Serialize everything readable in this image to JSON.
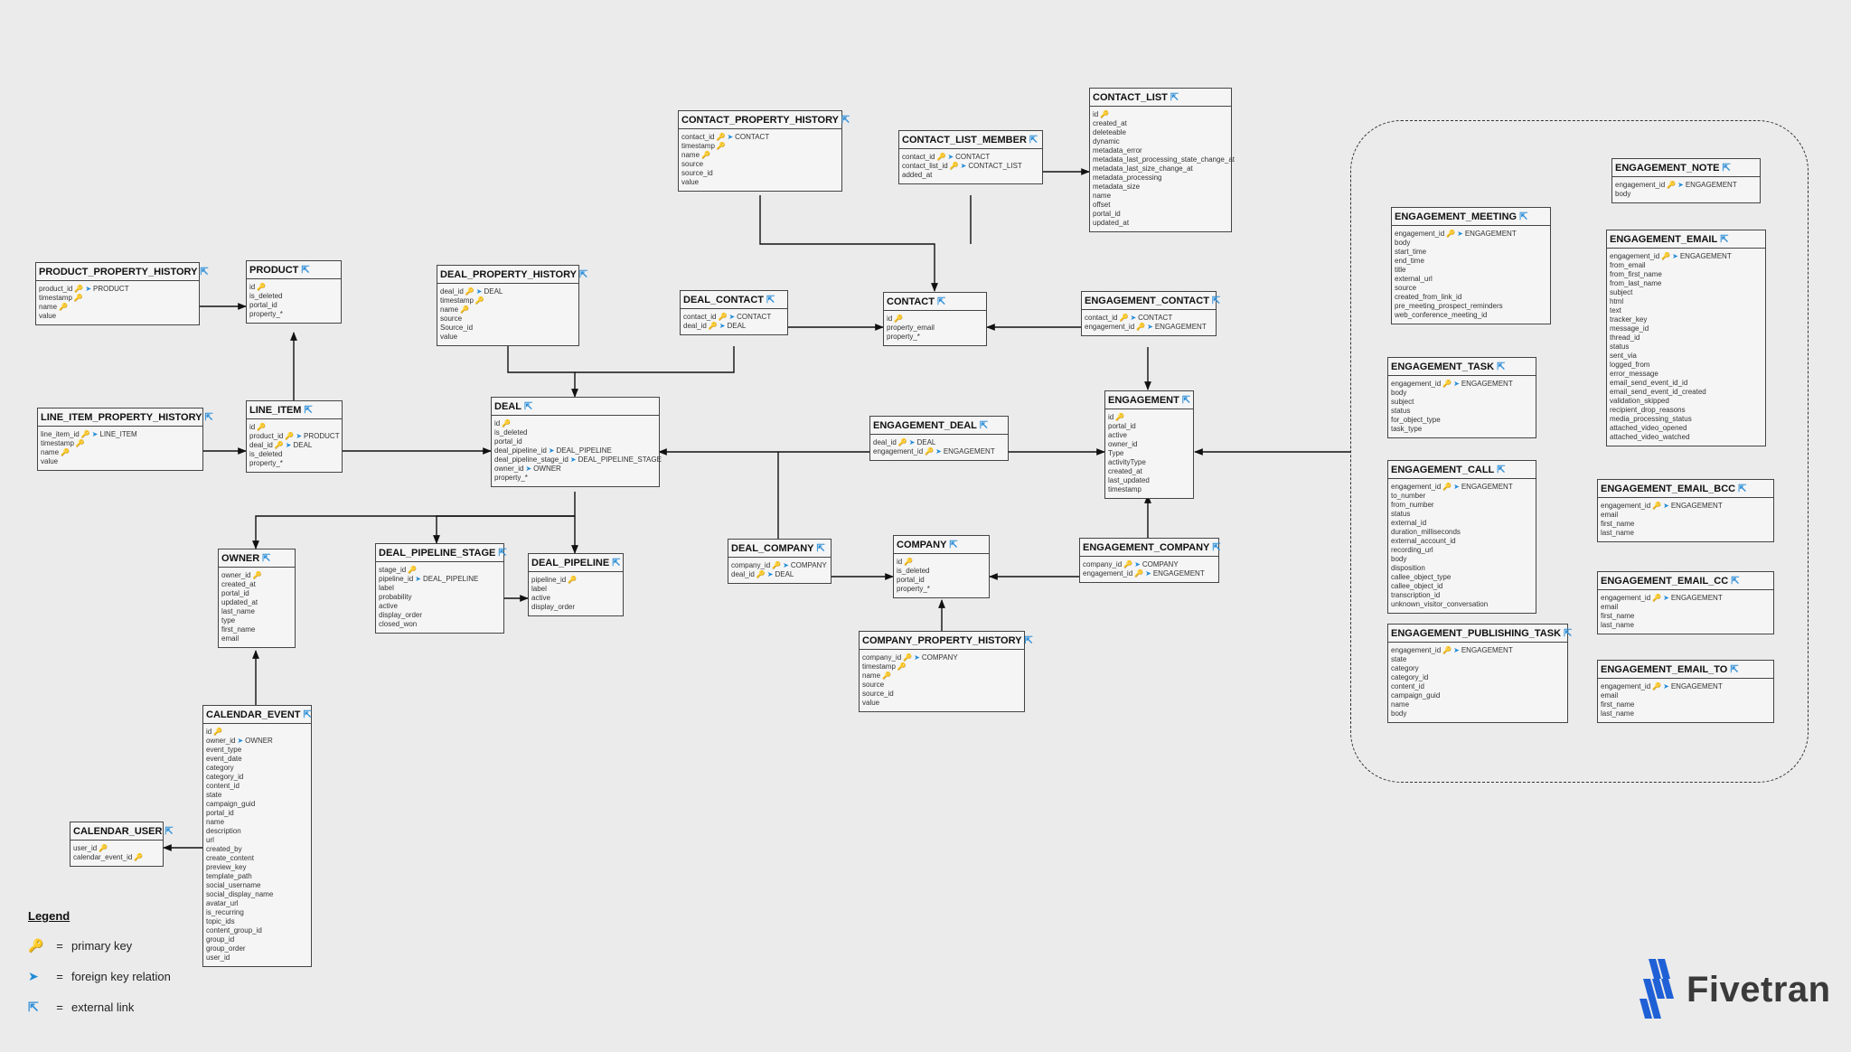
{
  "icons": {
    "primary_key": "key-icon",
    "foreign_key": "arrow-right-icon",
    "external_link": "external-link-icon"
  },
  "colors": {
    "background": "#ebebeb",
    "table_fill": "#f5f5f5",
    "border": "#444444",
    "pk": "#e0a81c",
    "fk": "#1f8ad8",
    "logo_blue": "#1f60d6"
  },
  "tables": [
    {
      "id": "CONTACT_PROPERTY_HISTORY",
      "name": "CONTACT_PROPERTY_HISTORY",
      "columns": [
        {
          "name": "contact_id",
          "pk": true,
          "fk": "CONTACT"
        },
        {
          "name": "timestamp",
          "pk": true
        },
        {
          "name": "name",
          "pk": true
        },
        {
          "name": "source"
        },
        {
          "name": "source_id"
        },
        {
          "name": "value"
        }
      ]
    },
    {
      "id": "CONTACT_LIST_MEMBER",
      "name": "CONTACT_LIST_MEMBER",
      "columns": [
        {
          "name": "contact_id",
          "pk": true,
          "fk": "CONTACT"
        },
        {
          "name": "contact_list_id",
          "pk": true,
          "fk": "CONTACT_LIST"
        },
        {
          "name": "added_at"
        }
      ]
    },
    {
      "id": "CONTACT_LIST",
      "name": "CONTACT_LIST",
      "columns": [
        {
          "name": "id",
          "pk": true
        },
        {
          "name": "created_at"
        },
        {
          "name": "deleteable"
        },
        {
          "name": "dynamic"
        },
        {
          "name": "metadata_error"
        },
        {
          "name": "metadata_last_processing_state_change_at"
        },
        {
          "name": "metadata_last_size_change_at"
        },
        {
          "name": "metadata_processing"
        },
        {
          "name": "metadata_size"
        },
        {
          "name": "name"
        },
        {
          "name": "offset"
        },
        {
          "name": "portal_id"
        },
        {
          "name": "updated_at"
        }
      ]
    },
    {
      "id": "PRODUCT_PROPERTY_HISTORY",
      "name": "PRODUCT_PROPERTY_HISTORY",
      "columns": [
        {
          "name": "product_id",
          "pk": true,
          "fk": "PRODUCT"
        },
        {
          "name": "timestamp",
          "pk": true
        },
        {
          "name": "name",
          "pk": true
        },
        {
          "name": "value"
        }
      ]
    },
    {
      "id": "PRODUCT",
      "name": "PRODUCT",
      "columns": [
        {
          "name": "id",
          "pk": true
        },
        {
          "name": "is_deleted"
        },
        {
          "name": "portal_id"
        },
        {
          "name": "property_*"
        }
      ]
    },
    {
      "id": "DEAL_PROPERTY_HISTORY",
      "name": "DEAL_PROPERTY_HISTORY",
      "columns": [
        {
          "name": "deal_id",
          "pk": true,
          "fk": "DEAL"
        },
        {
          "name": "timestamp",
          "pk": true
        },
        {
          "name": "name",
          "pk": true
        },
        {
          "name": "source"
        },
        {
          "name": "Source_id"
        },
        {
          "name": "value"
        }
      ]
    },
    {
      "id": "DEAL_CONTACT",
      "name": "DEAL_CONTACT",
      "columns": [
        {
          "name": "contact_id",
          "pk": true,
          "fk": "CONTACT"
        },
        {
          "name": "deal_id",
          "pk": true,
          "fk": "DEAL"
        }
      ]
    },
    {
      "id": "CONTACT",
      "name": "CONTACT",
      "columns": [
        {
          "name": "id",
          "pk": true
        },
        {
          "name": "property_email"
        },
        {
          "name": "property_*"
        }
      ]
    },
    {
      "id": "ENGAGEMENT_CONTACT",
      "name": "ENGAGEMENT_CONTACT",
      "columns": [
        {
          "name": "contact_id",
          "pk": true,
          "fk": "CONTACT"
        },
        {
          "name": "engagement_id",
          "pk": true,
          "fk": "ENGAGEMENT"
        }
      ]
    },
    {
      "id": "LINE_ITEM_PROPERTY_HISTORY",
      "name": "LINE_ITEM_PROPERTY_HISTORY",
      "columns": [
        {
          "name": "line_item_id",
          "pk": true,
          "fk": "LINE_ITEM"
        },
        {
          "name": "timestamp",
          "pk": true
        },
        {
          "name": "name",
          "pk": true
        },
        {
          "name": "value"
        }
      ]
    },
    {
      "id": "LINE_ITEM",
      "name": "LINE_ITEM",
      "columns": [
        {
          "name": "id",
          "pk": true
        },
        {
          "name": "product_id",
          "pk": true,
          "fk": "PRODUCT"
        },
        {
          "name": "deal_id",
          "pk": true,
          "fk": "DEAL"
        },
        {
          "name": "is_deleted"
        },
        {
          "name": "property_*"
        }
      ]
    },
    {
      "id": "DEAL",
      "name": "DEAL",
      "columns": [
        {
          "name": "id",
          "pk": true
        },
        {
          "name": "is_deleted"
        },
        {
          "name": "portal_id"
        },
        {
          "name": "deal_pipeline_id",
          "fk": "DEAL_PIPELINE"
        },
        {
          "name": "deal_pipeline_stage_id",
          "fk": "DEAL_PIPELINE_STAGE"
        },
        {
          "name": "owner_id",
          "fk": "OWNER"
        },
        {
          "name": "property_*"
        }
      ]
    },
    {
      "id": "ENGAGEMENT_DEAL",
      "name": "ENGAGEMENT_DEAL",
      "columns": [
        {
          "name": "deal_id",
          "pk": true,
          "fk": "DEAL"
        },
        {
          "name": "engagement_id",
          "pk": true,
          "fk": "ENGAGEMENT"
        }
      ]
    },
    {
      "id": "ENGAGEMENT",
      "name": "ENGAGEMENT",
      "columns": [
        {
          "name": "id",
          "pk": true
        },
        {
          "name": "portal_id"
        },
        {
          "name": "active"
        },
        {
          "name": "owner_id"
        },
        {
          "name": "Type"
        },
        {
          "name": "activityType"
        },
        {
          "name": "created_at"
        },
        {
          "name": "last_updated"
        },
        {
          "name": "timestamp"
        }
      ]
    },
    {
      "id": "OWNER",
      "name": "OWNER",
      "columns": [
        {
          "name": "owner_id",
          "pk": true
        },
        {
          "name": "created_at"
        },
        {
          "name": "portal_id"
        },
        {
          "name": "updated_at"
        },
        {
          "name": "last_name"
        },
        {
          "name": "type"
        },
        {
          "name": "first_name"
        },
        {
          "name": "email"
        }
      ]
    },
    {
      "id": "DEAL_PIPELINE_STAGE",
      "name": "DEAL_PIPELINE_STAGE",
      "columns": [
        {
          "name": "stage_id",
          "pk": true
        },
        {
          "name": "pipeline_id",
          "fk": "DEAL_PIPELINE"
        },
        {
          "name": "label"
        },
        {
          "name": "probability"
        },
        {
          "name": "active"
        },
        {
          "name": "display_order"
        },
        {
          "name": "closed_won"
        }
      ]
    },
    {
      "id": "DEAL_PIPELINE",
      "name": "DEAL_PIPELINE",
      "columns": [
        {
          "name": "pipeline_id",
          "pk": true
        },
        {
          "name": "label"
        },
        {
          "name": "active"
        },
        {
          "name": "display_order"
        }
      ]
    },
    {
      "id": "DEAL_COMPANY",
      "name": "DEAL_COMPANY",
      "columns": [
        {
          "name": "company_id",
          "pk": true,
          "fk": "COMPANY"
        },
        {
          "name": "deal_id",
          "pk": true,
          "fk": "DEAL"
        }
      ]
    },
    {
      "id": "COMPANY",
      "name": "COMPANY",
      "columns": [
        {
          "name": "id",
          "pk": true
        },
        {
          "name": "is_deleted"
        },
        {
          "name": "portal_id"
        },
        {
          "name": "property_*"
        }
      ]
    },
    {
      "id": "ENGAGEMENT_COMPANY",
      "name": "ENGAGEMENT_COMPANY",
      "columns": [
        {
          "name": "company_id",
          "pk": true,
          "fk": "COMPANY"
        },
        {
          "name": "engagement_id",
          "pk": true,
          "fk": "ENGAGEMENT"
        }
      ]
    },
    {
      "id": "COMPANY_PROPERTY_HISTORY",
      "name": "COMPANY_PROPERTY_HISTORY",
      "columns": [
        {
          "name": "company_id",
          "pk": true,
          "fk": "COMPANY"
        },
        {
          "name": "timestamp",
          "pk": true
        },
        {
          "name": "name",
          "pk": true
        },
        {
          "name": "source"
        },
        {
          "name": "source_id"
        },
        {
          "name": "value"
        }
      ]
    },
    {
      "id": "CALENDAR_EVENT",
      "name": "CALENDAR_EVENT",
      "columns": [
        {
          "name": "id",
          "pk": true
        },
        {
          "name": "owner_id",
          "fk": "OWNER"
        },
        {
          "name": "event_type"
        },
        {
          "name": "event_date"
        },
        {
          "name": "category"
        },
        {
          "name": "category_id"
        },
        {
          "name": "content_id"
        },
        {
          "name": "state"
        },
        {
          "name": "campaign_guid"
        },
        {
          "name": "portal_id"
        },
        {
          "name": "name"
        },
        {
          "name": "description"
        },
        {
          "name": "url"
        },
        {
          "name": "created_by"
        },
        {
          "name": "create_content"
        },
        {
          "name": "preview_key"
        },
        {
          "name": "template_path"
        },
        {
          "name": "social_username"
        },
        {
          "name": "social_display_name"
        },
        {
          "name": "avatar_url"
        },
        {
          "name": "is_recurring"
        },
        {
          "name": "topic_ids"
        },
        {
          "name": "content_group_id"
        },
        {
          "name": "group_id"
        },
        {
          "name": "group_order"
        },
        {
          "name": "user_id"
        }
      ]
    },
    {
      "id": "CALENDAR_USER",
      "name": "CALENDAR_USER",
      "columns": [
        {
          "name": "user_id",
          "pk": true
        },
        {
          "name": "calendar_event_id",
          "pk": true
        }
      ]
    },
    {
      "id": "ENGAGEMENT_MEETING",
      "name": "ENGAGEMENT_MEETING",
      "columns": [
        {
          "name": "engagement_id",
          "pk": true,
          "fk": "ENGAGEMENT"
        },
        {
          "name": "body"
        },
        {
          "name": "start_time"
        },
        {
          "name": "end_time"
        },
        {
          "name": "title"
        },
        {
          "name": "external_url"
        },
        {
          "name": "source"
        },
        {
          "name": "created_from_link_id"
        },
        {
          "name": "pre_meeting_prospect_reminders"
        },
        {
          "name": "web_conference_meeting_id"
        }
      ]
    },
    {
      "id": "ENGAGEMENT_NOTE",
      "name": "ENGAGEMENT_NOTE",
      "columns": [
        {
          "name": "engagement_id",
          "pk": true,
          "fk": "ENGAGEMENT"
        },
        {
          "name": "body"
        }
      ]
    },
    {
      "id": "ENGAGEMENT_EMAIL",
      "name": "ENGAGEMENT_EMAIL",
      "columns": [
        {
          "name": "engagement_id",
          "pk": true,
          "fk": "ENGAGEMENT"
        },
        {
          "name": "from_email"
        },
        {
          "name": "from_first_name"
        },
        {
          "name": "from_last_name"
        },
        {
          "name": "subject"
        },
        {
          "name": "html"
        },
        {
          "name": "text"
        },
        {
          "name": "tracker_key"
        },
        {
          "name": "message_id"
        },
        {
          "name": "thread_id"
        },
        {
          "name": "status"
        },
        {
          "name": "sent_via"
        },
        {
          "name": "logged_from"
        },
        {
          "name": "error_message"
        },
        {
          "name": "email_send_event_id_id"
        },
        {
          "name": "email_send_event_id_created"
        },
        {
          "name": "validation_skipped"
        },
        {
          "name": "recipient_drop_reasons"
        },
        {
          "name": "media_processing_status"
        },
        {
          "name": "attached_video_opened"
        },
        {
          "name": "attached_video_watched"
        }
      ]
    },
    {
      "id": "ENGAGEMENT_TASK",
      "name": "ENGAGEMENT_TASK",
      "columns": [
        {
          "name": "engagement_id",
          "pk": true,
          "fk": "ENGAGEMENT"
        },
        {
          "name": "body"
        },
        {
          "name": "subject"
        },
        {
          "name": "status"
        },
        {
          "name": "for_object_type"
        },
        {
          "name": "task_type"
        }
      ]
    },
    {
      "id": "ENGAGEMENT_CALL",
      "name": "ENGAGEMENT_CALL",
      "columns": [
        {
          "name": "engagement_id",
          "pk": true,
          "fk": "ENGAGEMENT"
        },
        {
          "name": "to_number"
        },
        {
          "name": "from_number"
        },
        {
          "name": "status"
        },
        {
          "name": "external_id"
        },
        {
          "name": "duration_milliseconds"
        },
        {
          "name": "external_account_id"
        },
        {
          "name": "recording_url"
        },
        {
          "name": "body"
        },
        {
          "name": "disposition"
        },
        {
          "name": "callee_object_type"
        },
        {
          "name": "callee_object_id"
        },
        {
          "name": "transcription_id"
        },
        {
          "name": "unknown_visitor_conversation"
        }
      ]
    },
    {
      "id": "ENGAGEMENT_EMAIL_BCC",
      "name": "ENGAGEMENT_EMAIL_BCC",
      "columns": [
        {
          "name": "engagement_id",
          "pk": true,
          "fk": "ENGAGEMENT"
        },
        {
          "name": "email"
        },
        {
          "name": "first_name"
        },
        {
          "name": "last_name"
        }
      ]
    },
    {
      "id": "ENGAGEMENT_EMAIL_CC",
      "name": "ENGAGEMENT_EMAIL_CC",
      "columns": [
        {
          "name": "engagement_id",
          "pk": true,
          "fk": "ENGAGEMENT"
        },
        {
          "name": "email"
        },
        {
          "name": "first_name"
        },
        {
          "name": "last_name"
        }
      ]
    },
    {
      "id": "ENGAGEMENT_PUBLISHING_TASK",
      "name": "ENGAGEMENT_PUBLISHING_TASK",
      "columns": [
        {
          "name": "engagement_id",
          "pk": true,
          "fk": "ENGAGEMENT"
        },
        {
          "name": "state"
        },
        {
          "name": "category"
        },
        {
          "name": "category_id"
        },
        {
          "name": "content_id"
        },
        {
          "name": "campaign_guid"
        },
        {
          "name": "name"
        },
        {
          "name": "body"
        }
      ]
    },
    {
      "id": "ENGAGEMENT_EMAIL_TO",
      "name": "ENGAGEMENT_EMAIL_TO",
      "columns": [
        {
          "name": "engagement_id",
          "pk": true,
          "fk": "ENGAGEMENT"
        },
        {
          "name": "email"
        },
        {
          "name": "first_name"
        },
        {
          "name": "last_name"
        }
      ]
    }
  ],
  "legend": {
    "title": "Legend",
    "items": [
      {
        "icon": "key-icon",
        "equals": "=",
        "label": "primary key"
      },
      {
        "icon": "arrow-right-icon",
        "equals": "=",
        "label": "foreign key relation"
      },
      {
        "icon": "external-link-icon",
        "equals": "=",
        "label": "external link"
      }
    ]
  },
  "logo": {
    "text": "Fivetran"
  }
}
